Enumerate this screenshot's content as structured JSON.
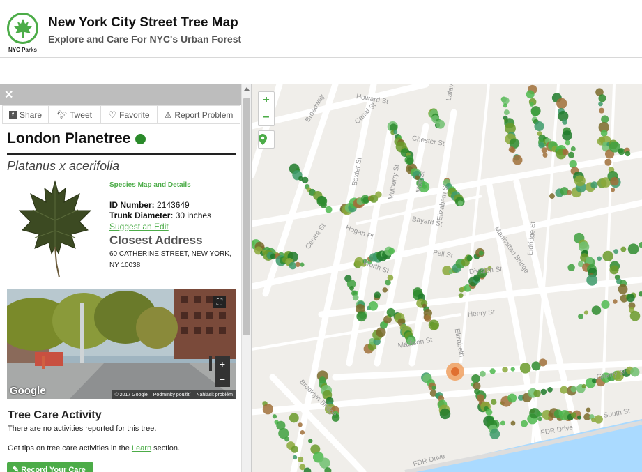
{
  "header": {
    "logo_text": "NYC Parks",
    "title": "New York City Street Tree Map",
    "subtitle": "Explore and Care For NYC's Urban Forest"
  },
  "panel": {
    "close_icon": "close-icon",
    "share_buttons": [
      {
        "label": "Share",
        "icon": "facebook-icon"
      },
      {
        "label": "Tweet",
        "icon": "twitter-icon"
      },
      {
        "label": "Favorite",
        "icon": "heart-icon"
      },
      {
        "label": "Report Problem",
        "icon": "warning-icon"
      }
    ],
    "species": "London Planetree",
    "status_color": "#2a8a2a",
    "scientific_name": "Platanus x acerifolia",
    "species_link": "Species Map and Details",
    "id_label": "ID Number:",
    "id_value": "2143649",
    "trunk_label": "Trunk Diameter:",
    "trunk_value": "30 inches",
    "suggest_edit": "Suggest an Edit",
    "address_heading": "Closest Address",
    "address_line1": "60 CATHERINE STREET, NEW YORK,",
    "address_line2": "NY 10038",
    "streetview": {
      "google": "Google",
      "copyright": "© 2017 Google",
      "terms": "Podmínky použití",
      "report": "Nahlásit problém"
    },
    "care_title": "Tree Care Activity",
    "care_text": "There are no activities reported for this tree.",
    "care_tips_before": "Get tips on tree care activities in the",
    "care_tips_link": "Learn",
    "care_tips_after": "section.",
    "record_button": "Record Your Care"
  },
  "map": {
    "zoom_in": "+",
    "zoom_out": "−",
    "locate_icon": "location-pin-icon",
    "accent": "#4cac48",
    "selected_tree_color": "#f0a060",
    "streets": [
      "Canal St",
      "Broadway",
      "Baxter St",
      "Mulberry St",
      "Mott St",
      "Elizabeth St",
      "Bayard St",
      "Pell St",
      "Hogan Pl",
      "Worth St",
      "Centre St",
      "Division St",
      "Henry St",
      "Madison St",
      "Manhattan Bridge",
      "Eldridge St",
      "Cherry St",
      "South St",
      "FDR Drive",
      "Brooklyn Bridge",
      "Chester St",
      "Howard St",
      "Lafayette St",
      "Elizabeth"
    ]
  }
}
